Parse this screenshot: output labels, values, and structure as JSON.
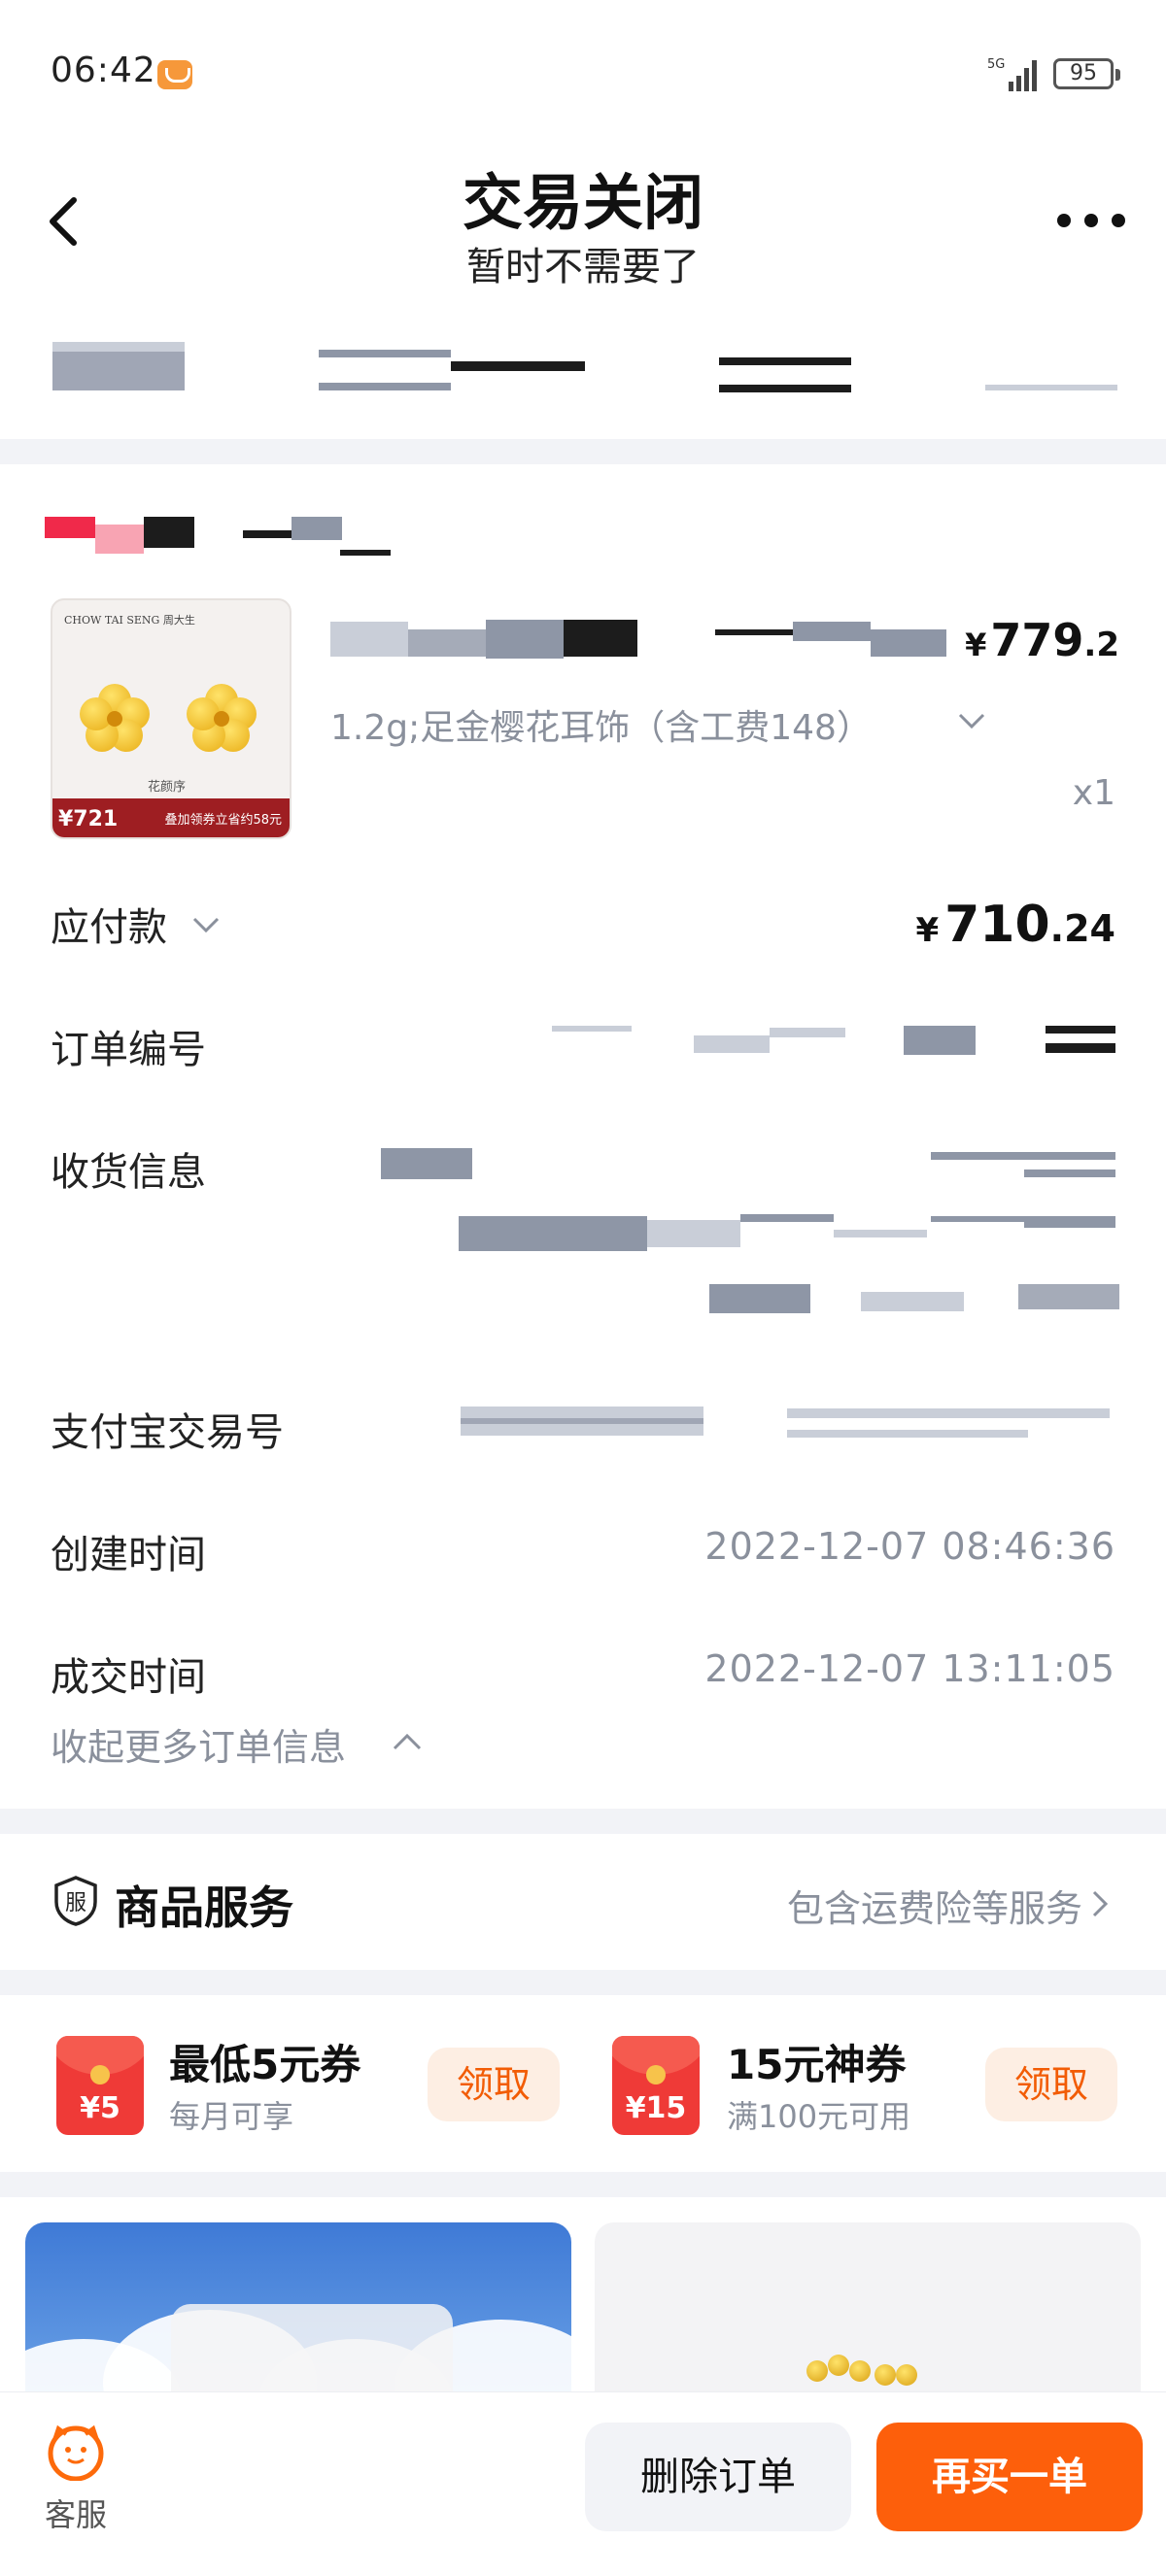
{
  "status_bar": {
    "time": "06:42",
    "network": "5G",
    "battery": "95"
  },
  "header": {
    "title": "交易关闭",
    "subtitle": "暂时不需要了"
  },
  "product": {
    "thumbnail": {
      "brand": "CHOW TAI SENG 周大生",
      "sub_label": "花颜序",
      "price_badge": "¥721",
      "note": "叠加领券立省约58元"
    },
    "price_symbol": "¥",
    "price_int": "779",
    "price_dec": ".2",
    "sku": "1.2g;足金樱花耳饰（含工费148）",
    "quantity": "x1"
  },
  "order": {
    "payable_label": "应付款",
    "payable_symbol": "¥",
    "payable_int": "710",
    "payable_dec": ".24",
    "order_no_label": "订单编号",
    "shipping_label": "收货信息",
    "alipay_label": "支付宝交易号",
    "created_label": "创建时间",
    "created_value": "2022-12-07 08:46:36",
    "closed_label": "成交时间",
    "closed_value": "2022-12-07 13:11:05",
    "collapse_label": "收起更多订单信息"
  },
  "service": {
    "icon_char": "服",
    "title": "商品服务",
    "desc": "包含运费险等服务"
  },
  "coupons": [
    {
      "amount": "¥5",
      "title": "最低5元券",
      "sub": "每月可享",
      "button": "领取"
    },
    {
      "amount": "¥15",
      "title": "15元神券",
      "sub": "满100元可用",
      "button": "领取"
    }
  ],
  "bottom_bar": {
    "customer_service": "客服",
    "delete_button": "删除订单",
    "rebuy_button": "再买一单"
  },
  "colors": {
    "accent_orange": "#fd5f0b",
    "coupon_red": "#ef3a37",
    "muted_text": "#8a909c",
    "section_bg": "#f2f3f7"
  }
}
